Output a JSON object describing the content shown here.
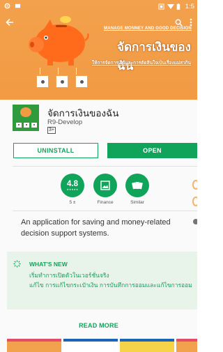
{
  "status_bar": {
    "time": "1:5"
  },
  "hero": {
    "tagline": "MANAGE MONNEY AND GOOD DECISION",
    "title": "จัดการเงินของฉัน",
    "subtitle": "ให้การจัดการเงินและการตัดสินใจเป็นเรื่องแม่สวกิน"
  },
  "app": {
    "name": "จัดการเงินของฉัน",
    "developer": "R9-Develop",
    "content_rating": "3+"
  },
  "buttons": {
    "uninstall": "UNINSTALL",
    "open": "OPEN"
  },
  "stats": {
    "rating_value": "4.8",
    "rating_stars": "★★★★★",
    "rating_count": "5 ±",
    "category_label": "Finance",
    "similar_label": "Similar"
  },
  "description": "An application for saving and money-related decision support systems.",
  "whats_new": {
    "title": "WHAT'S NEW",
    "line1": "เริ่มทำการเปิดตัวในเวอร์ชั่นจริง",
    "line2": "แก้ไข การแก้ไขกระเป๋าเงิน การบันทึกการออมและแก้ไขการออม"
  },
  "read_more": "READ MORE",
  "colors": {
    "accent": "#10a45a",
    "hero_orange": "#f29a44",
    "whats_new_bg": "#e8f4ea"
  },
  "icons": {
    "back": "arrow-left-icon",
    "search": "search-icon",
    "more": "more-vertical-icon",
    "finance": "image-icon",
    "similar": "cards-icon",
    "whats_new": "sparkle-icon"
  }
}
